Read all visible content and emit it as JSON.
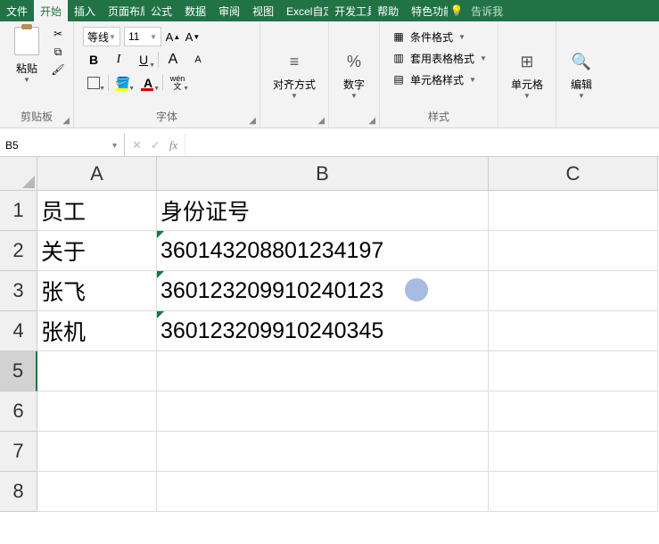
{
  "tabs": [
    "文件",
    "开始",
    "插入",
    "页面布局",
    "公式",
    "数据",
    "审阅",
    "视图",
    "Excel自定",
    "开发工具",
    "帮助",
    "特色功能"
  ],
  "active_tab": 1,
  "tell_me": "告诉我",
  "ribbon": {
    "clipboard": {
      "paste": "粘贴",
      "label": "剪贴板"
    },
    "font": {
      "name": "等线",
      "size": "11",
      "bold": "B",
      "italic": "I",
      "underline": "U",
      "increase": "A",
      "decrease": "A",
      "phonetic": "wén",
      "phonetic2": "文",
      "label": "字体"
    },
    "alignment": {
      "title": "对齐方式"
    },
    "number": {
      "title": "数字",
      "symbol": "%"
    },
    "styles": {
      "cond": "条件格式",
      "table": "套用表格格式",
      "cell": "单元格样式",
      "label": "样式"
    },
    "cells": {
      "title": "单元格"
    },
    "editing": {
      "title": "编辑"
    }
  },
  "name_box": "B5",
  "columns": [
    "A",
    "B",
    "C"
  ],
  "rows": [
    "1",
    "2",
    "3",
    "4",
    "5",
    "6",
    "7",
    "8"
  ],
  "cells": {
    "A1": "员工",
    "B1": "身份证号",
    "A2": "关于",
    "B2": "360143208801234197",
    "A3": "张飞",
    "B3": "360123209910240123",
    "A4": "张机",
    "B4": "360123209910240345"
  }
}
